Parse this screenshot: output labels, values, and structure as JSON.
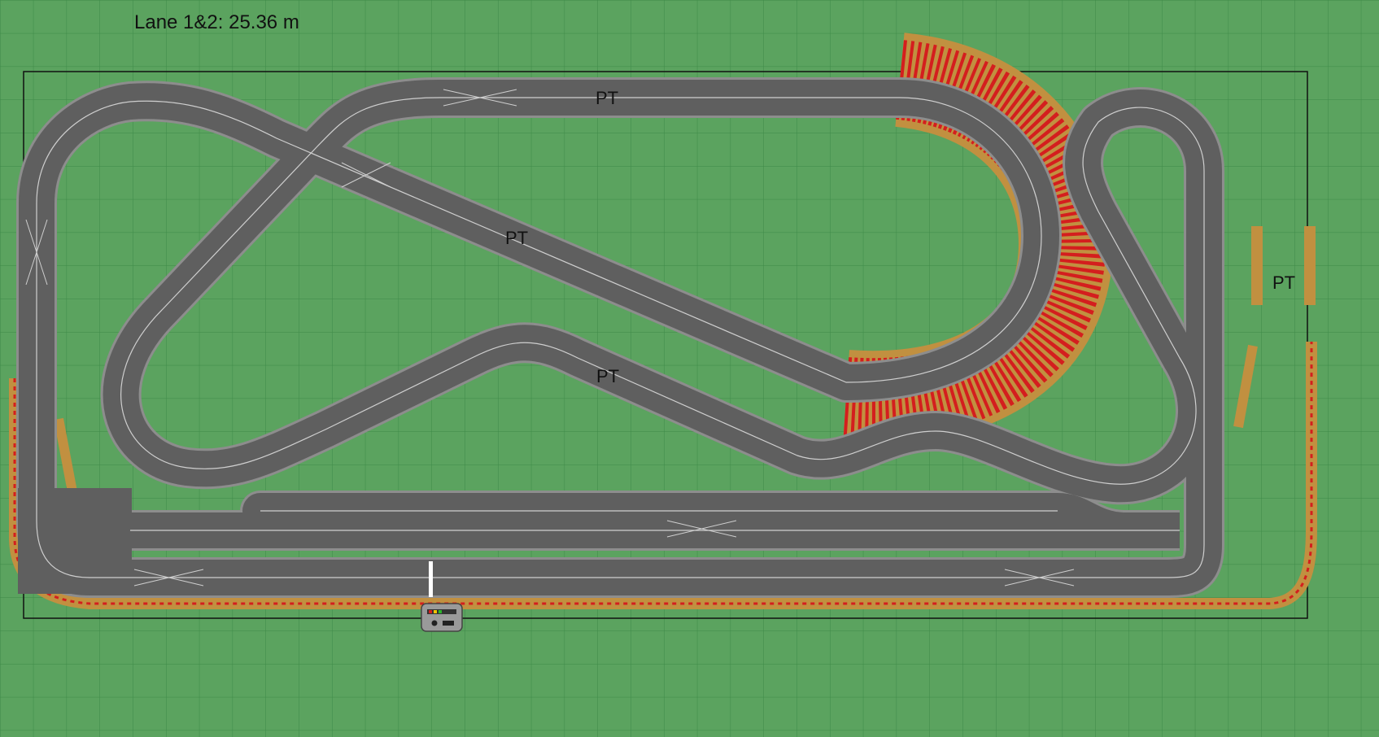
{
  "header": {
    "lane_length": "Lane 1&2: 25.36 m"
  },
  "pt_label": "PT",
  "colors": {
    "grass": "#5ba35f",
    "grid": "#3d8a47",
    "track": "#5f5f5f",
    "track_edge": "#8d8d8d",
    "lane_line": "#cfcfcf",
    "border": "#c19040",
    "kerb": "#d41e1e",
    "frame": "#111111"
  },
  "icons": {
    "power_base": "lap-counter-icon"
  }
}
